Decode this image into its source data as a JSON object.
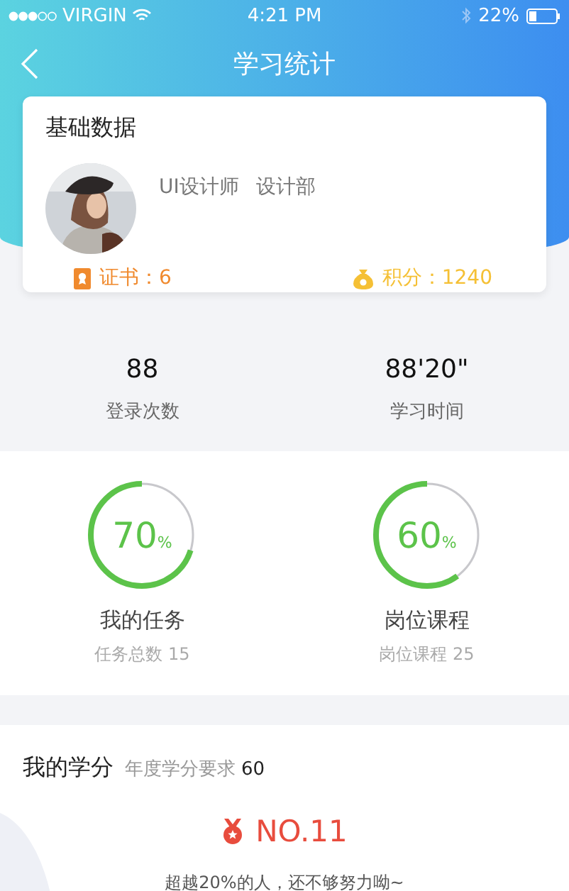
{
  "status_bar": {
    "carrier": "VIRGIN",
    "time": "4:21 PM",
    "battery": "22%"
  },
  "nav": {
    "title": "学习统计"
  },
  "profile_card": {
    "title": "基础数据",
    "role": "UI设计师",
    "department": "设计部",
    "certificates": "证书：6",
    "points": "积分：1240"
  },
  "stats": [
    {
      "value": "88",
      "label": "登录次数"
    },
    {
      "value": "88'20\"",
      "label": "学习时间"
    }
  ],
  "progress": [
    {
      "percent": "70",
      "unit": "%",
      "level": 0.7,
      "title": "我的任务",
      "subtitle": "任务总数 15"
    },
    {
      "percent": "60",
      "unit": "%",
      "level": 0.6,
      "title": "岗位课程",
      "subtitle": "岗位课程 25"
    }
  ],
  "credits": {
    "title": "我的学分",
    "requirement_label": "年度学分要求",
    "requirement_value": "60",
    "rank": "NO.11",
    "message": "超越20%的人，还不够努力呦~"
  }
}
